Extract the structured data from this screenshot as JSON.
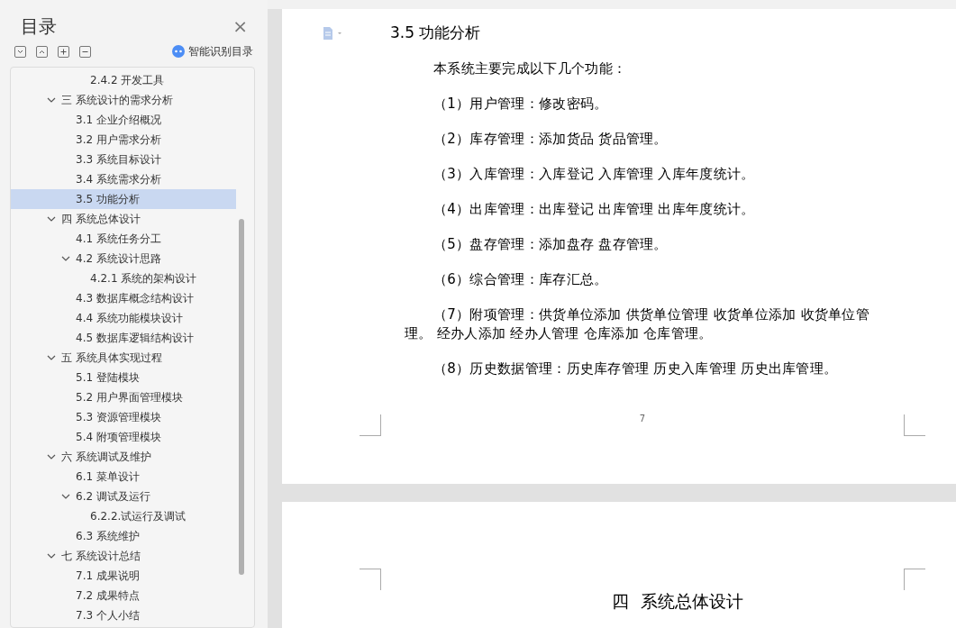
{
  "sidebar": {
    "title": "目录",
    "close_label": "×",
    "smart_toc_label": "智能识别目录",
    "toc": [
      {
        "children": [
          {
            "children": [
              {
                "label": "2.4.2 开发工具",
                "selected": false
              }
            ]
          }
        ]
      },
      {
        "label": "三 系统设计的需求分析",
        "expanded": true,
        "selected": false,
        "children": [
          {
            "label": "3.1 企业介绍概况",
            "selected": false
          },
          {
            "label": "3.2 用户需求分析",
            "selected": false
          },
          {
            "label": "3.3 系统目标设计",
            "selected": false
          },
          {
            "label": "3.4 系统需求分析",
            "selected": false
          },
          {
            "label": "3.5 功能分析",
            "selected": true
          }
        ]
      },
      {
        "label": "四 系统总体设计",
        "expanded": true,
        "selected": false,
        "children": [
          {
            "label": "4.1 系统任务分工",
            "selected": false
          },
          {
            "label": "4.2 系统设计思路",
            "expanded": true,
            "selected": false,
            "children": [
              {
                "label": "4.2.1 系统的架构设计",
                "selected": false
              }
            ]
          },
          {
            "label": "4.3 数据库概念结构设计",
            "selected": false
          },
          {
            "label": "4.4 系统功能模块设计",
            "selected": false
          },
          {
            "label": "4.5 数据库逻辑结构设计",
            "selected": false
          }
        ]
      },
      {
        "label": "五 系统具体实现过程",
        "expanded": true,
        "selected": false,
        "children": [
          {
            "label": "5.1 登陆模块",
            "selected": false
          },
          {
            "label": "5.2 用户界面管理模块",
            "selected": false
          },
          {
            "label": "5.3 资源管理模块",
            "selected": false
          },
          {
            "label": "5.4 附项管理模块",
            "selected": false
          }
        ]
      },
      {
        "label": "六 系统调试及维护",
        "expanded": true,
        "selected": false,
        "children": [
          {
            "label": "6.1 菜单设计",
            "selected": false
          },
          {
            "label": "6.2 调试及运行",
            "expanded": true,
            "selected": false,
            "children": [
              {
                "label": "6.2.2.试运行及调试",
                "selected": false
              }
            ]
          },
          {
            "label": "6.3 系统维护",
            "selected": false
          }
        ]
      },
      {
        "label": "七 系统设计总结",
        "expanded": true,
        "selected": false,
        "children": [
          {
            "label": "7.1 成果说明",
            "selected": false
          },
          {
            "label": "7.2 成果特点",
            "selected": false
          },
          {
            "label": "7.3 个人小结",
            "selected": false
          }
        ]
      }
    ]
  },
  "document": {
    "heading": "3.5 功能分析",
    "paragraphs": [
      "本系统主要完成以下几个功能：",
      "（1）用户管理：修改密码。",
      "（2）库存管理：添加货品 货品管理。",
      "（3）入库管理：入库登记 入库管理 入库年度统计。",
      "（4）出库管理：出库登记 出库管理 出库年度统计。",
      "（5）盘存管理：添加盘存 盘存管理。",
      "（6）综合管理：库存汇总。",
      "（7）附项管理：供货单位添加 供货单位管理 收货单位添加 收货单位管理。 经办人添加 经办人管理 仓库添加 仓库管理。",
      "（8）历史数据管理：历史库存管理 历史入库管理 历史出库管理。"
    ],
    "page_number": "7",
    "next_page_heading": "四  系统总体设计"
  }
}
